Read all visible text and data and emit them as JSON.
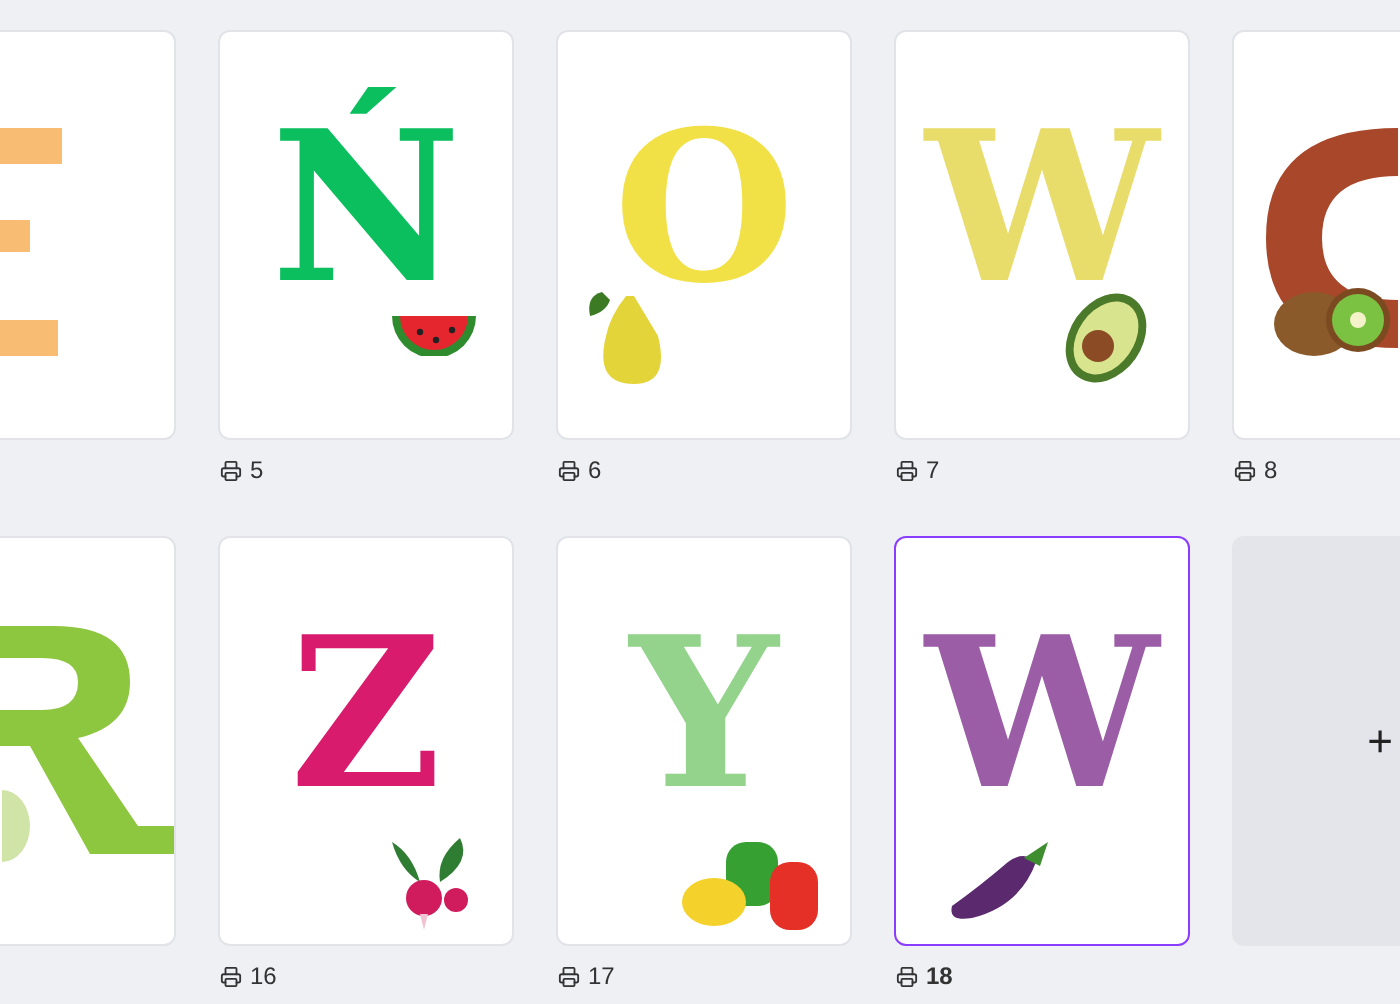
{
  "rows": [
    {
      "pages": [
        {
          "kind": "fragment_e",
          "color": "#f9bc73",
          "selected": false
        },
        {
          "kind": "page",
          "letter": "Ń",
          "color": "#0cbf5e",
          "decoration": {
            "kind": "watermelon"
          },
          "label": "5",
          "selected": false
        },
        {
          "kind": "page",
          "letter": "O",
          "color": "#f2e146",
          "decoration": {
            "kind": "pear"
          },
          "label": "6",
          "selected": false
        },
        {
          "kind": "page",
          "letter": "W",
          "color": "#e8dc6a",
          "decoration": {
            "kind": "avocado"
          },
          "label": "7",
          "selected": false
        },
        {
          "kind": "fragment_c",
          "color": "#a8472a",
          "decoration": {
            "kind": "kiwi"
          },
          "label": "8",
          "selected": false
        }
      ]
    },
    {
      "pages": [
        {
          "kind": "fragment_r",
          "color": "#8dc63f",
          "decoration": {
            "kind": "cabbage"
          },
          "selected": false
        },
        {
          "kind": "page",
          "letter": "Z",
          "color": "#d81b6d",
          "decoration": {
            "kind": "radish"
          },
          "label": "16",
          "selected": false
        },
        {
          "kind": "page",
          "letter": "Y",
          "color": "#93d38c",
          "decoration": {
            "kind": "peppers"
          },
          "label": "17",
          "selected": false
        },
        {
          "kind": "page",
          "letter": "W",
          "color": "#9b5ea6",
          "decoration": {
            "kind": "eggplant"
          },
          "label": "18",
          "selected": true
        },
        {
          "kind": "add",
          "symbol": "+"
        }
      ]
    }
  ]
}
